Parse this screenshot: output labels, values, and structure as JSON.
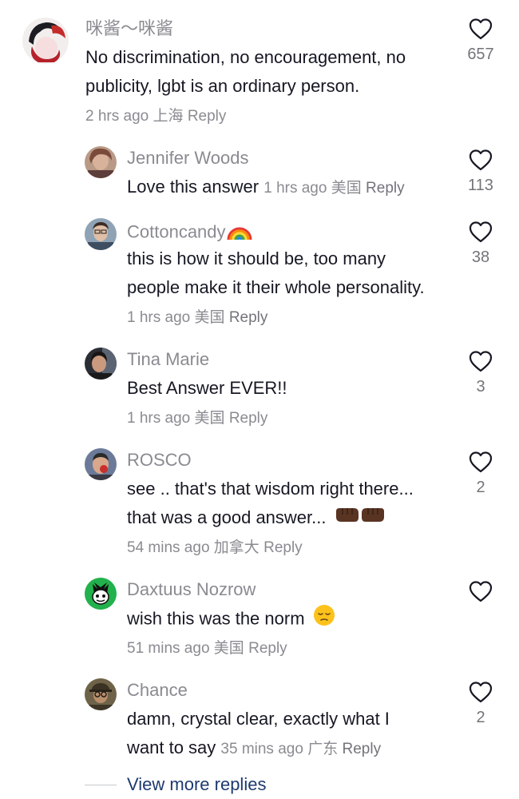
{
  "comments": [
    {
      "username": "咪酱～咪酱",
      "text": "No discrimination, no encouragement, no publicity, lgbt is an ordinary person.",
      "time": "2 hrs ago",
      "location": "上海",
      "reply_label": "Reply",
      "likes": "657",
      "avatar": "anime-avatar"
    }
  ],
  "replies": [
    {
      "username": "Jennifer Woods",
      "text": "Love this answer",
      "time": "1 hrs ago",
      "location": "美国",
      "reply_label": "Reply",
      "likes": "113"
    },
    {
      "username": "Cottoncandy",
      "username_emoji": "rainbow-emoji",
      "text": "this is how it should be, too many people make it their whole personality.",
      "time": "1 hrs ago",
      "location": "美国",
      "reply_label": "Reply",
      "likes": "38"
    },
    {
      "username": "Tina Marie",
      "text": "Best Answer EVER!!",
      "time": "1 hrs ago",
      "location": "美国",
      "reply_label": "Reply",
      "likes": "3"
    },
    {
      "username": "ROSCO",
      "text_line1": "see .. that's that wisdom right there...",
      "text_line2": "that was a good answer...",
      "text_emoji": "fist-bump-emoji",
      "time": "54 mins ago",
      "location": "加拿大",
      "reply_label": "Reply",
      "likes": "2"
    },
    {
      "username": "Daxtuus Nozrow",
      "text": "wish this was the norm",
      "text_emoji": "pensive-face-emoji",
      "time": "51 mins ago",
      "location": "美国",
      "reply_label": "Reply",
      "likes": ""
    },
    {
      "username": "Chance",
      "text_line1": "damn, crystal clear, exactly what I",
      "text_line2": "want to say",
      "time": "35 mins ago",
      "location": "广东",
      "reply_label": "Reply",
      "likes": "2"
    }
  ],
  "view_more_label": "View more replies",
  "icons": {
    "like": "heart-outline-icon"
  },
  "colors": {
    "primary_text": "#161823",
    "secondary_text": "#8a8b91",
    "link": "#1e3a6e"
  }
}
